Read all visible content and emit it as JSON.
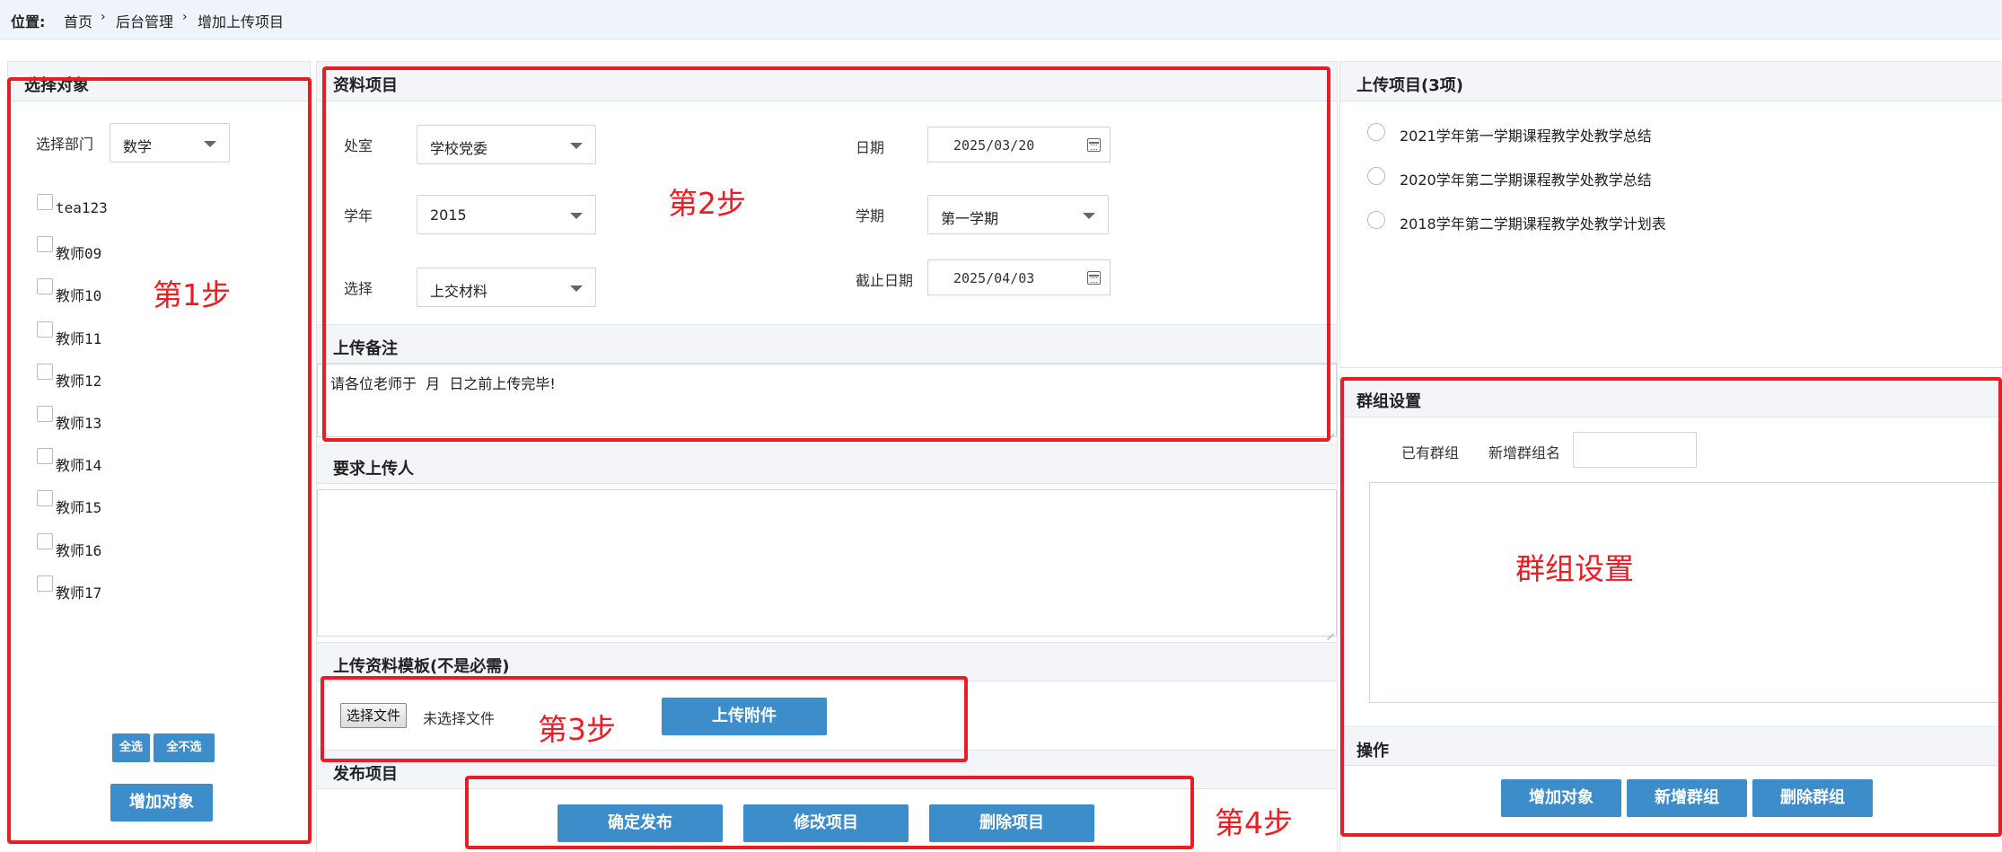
{
  "breadcrumb": {
    "label": "位置:",
    "items": [
      "首页",
      "后台管理",
      "增加上传项目"
    ],
    "separator": "›"
  },
  "left_panel": {
    "title": "选择对象",
    "dept_label": "选择部门",
    "dept_value": "数学",
    "teachers": [
      "tea123",
      "教师09",
      "教师10",
      "教师11",
      "教师12",
      "教师13",
      "教师14",
      "教师15",
      "教师16",
      "教师17"
    ],
    "select_all": "全选",
    "select_none": "全不选",
    "add_object": "增加对象"
  },
  "material": {
    "title": "资料项目",
    "office_label": "处室",
    "office_value": "学校党委",
    "year_label": "学年",
    "year_value": "2015",
    "choose_label": "选择",
    "choose_value": "上交材料",
    "date_label": "日期",
    "date_value": "2025/03/20",
    "term_label": "学期",
    "term_value": "第一学期",
    "deadline_label": "截止日期",
    "deadline_value": "2025/04/03"
  },
  "remark": {
    "title": "上传备注",
    "text": "请各位老师于  月  日之前上传完毕!"
  },
  "uploaders": {
    "title": "要求上传人"
  },
  "template": {
    "title": "上传资料模板(不是必需)",
    "choose_file": "选择文件",
    "no_file": "未选择文件",
    "upload_attachment": "上传附件"
  },
  "publish": {
    "title": "发布项目",
    "confirm": "确定发布",
    "modify": "修改项目",
    "delete": "删除项目"
  },
  "uploaded": {
    "title": "上传项目(3项)",
    "items": [
      "2021学年第一学期课程教学处教学总结",
      "2020学年第二学期课程教学处教学总结",
      "2018学年第二学期课程教学处教学计划表"
    ]
  },
  "group": {
    "title": "群组设置",
    "existing_label": "已有群组",
    "new_name_label": "新增群组名",
    "ops_title": "操作",
    "add_object": "增加对象",
    "new_group": "新增群组",
    "delete_group": "删除群组"
  },
  "annotations": {
    "step1": "第1步",
    "step2": "第2步",
    "step3": "第3步",
    "step4": "第4步",
    "group": "群组设置"
  },
  "colors": {
    "accent": "#3c8dc9",
    "annotation": "#ec1c24",
    "header_bg": "#eef4fa"
  }
}
